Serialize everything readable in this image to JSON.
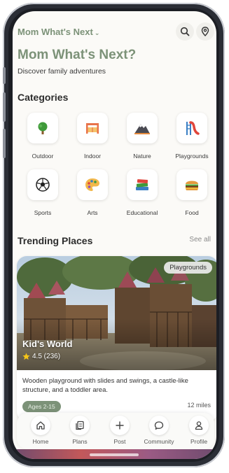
{
  "header": {
    "app_name": "Mom What's Next",
    "chevron": "⌄",
    "search_icon": "search-icon",
    "location_icon": "map-pin-icon"
  },
  "hero": {
    "title": "Mom What's Next?",
    "subtitle": "Discover family adventures"
  },
  "categories": {
    "title": "Categories",
    "items": [
      {
        "label": "Outdoor",
        "icon": "tree-icon"
      },
      {
        "label": "Indoor",
        "icon": "indoor-play-icon"
      },
      {
        "label": "Nature",
        "icon": "mountain-icon"
      },
      {
        "label": "Playgrounds",
        "icon": "slide-icon"
      },
      {
        "label": "Sports",
        "icon": "soccer-ball-icon"
      },
      {
        "label": "Arts",
        "icon": "palette-icon"
      },
      {
        "label": "Educational",
        "icon": "books-icon"
      },
      {
        "label": "Food",
        "icon": "burger-icon"
      }
    ]
  },
  "trending": {
    "title": "Trending Places",
    "see_all": "See all",
    "card": {
      "tag": "Playgrounds",
      "name": "Kid's World",
      "rating": "4.5 (236)",
      "description": "Wooden playground with slides and swings, a castle-like structure, and a toddler area.",
      "age": "Ages 2-15",
      "distance": "12 miles"
    }
  },
  "nav": {
    "items": [
      {
        "label": "Home",
        "icon": "home-icon"
      },
      {
        "label": "Plans",
        "icon": "plans-icon"
      },
      {
        "label": "Post",
        "icon": "plus-icon"
      },
      {
        "label": "Community",
        "icon": "chat-bubble-icon"
      },
      {
        "label": "Profile",
        "icon": "person-icon"
      }
    ]
  },
  "colors": {
    "accent": "#7c9278",
    "background": "#fbfaf7",
    "frame": "#2b2e36"
  }
}
